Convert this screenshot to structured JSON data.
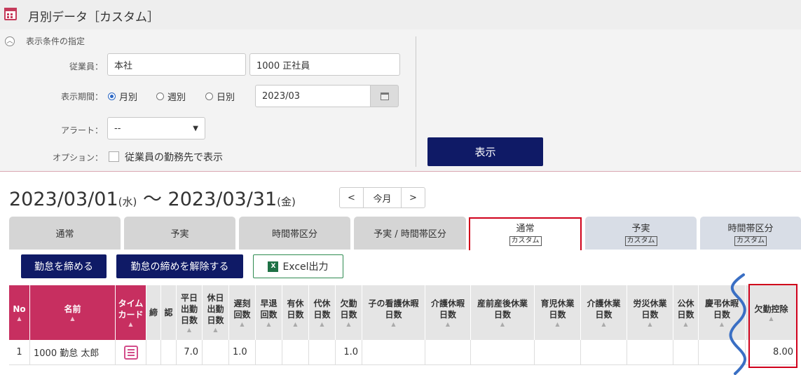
{
  "title_bar": {
    "title": "月別データ［カスタム］",
    "icon": "calendar-icon"
  },
  "conditions": {
    "heading": "表示条件の指定",
    "employee_label": "従業員：",
    "employee_org": "本社",
    "employee_value": "1000 正社員",
    "period_label": "表示期間：",
    "period_options": [
      "月別",
      "週別",
      "日別"
    ],
    "period_selected": "月別",
    "period_date": "2023/03",
    "alert_label": "アラート：",
    "alert_value": "--",
    "option_label": "オプション：",
    "option_checkbox_label": "従業員の勤務先で表示",
    "option_checked": false,
    "show_button": "表示"
  },
  "date_range": {
    "start": "2023/03/01",
    "start_dow": "(水)",
    "separator": "〜",
    "end": "2023/03/31",
    "end_dow": "(金)"
  },
  "nav": {
    "prev": "<",
    "current": "今月",
    "next": ">"
  },
  "tabs": [
    {
      "label": "通常",
      "sub": ""
    },
    {
      "label": "予実",
      "sub": ""
    },
    {
      "label": "時間帯区分",
      "sub": ""
    },
    {
      "label": "予実 / 時間帯区分",
      "sub": ""
    },
    {
      "label": "通常",
      "sub": "カスタム",
      "active": true
    },
    {
      "label": "予実",
      "sub": "カスタム"
    },
    {
      "label": "時間帯区分",
      "sub": "カスタム"
    }
  ],
  "toolbar": {
    "close_button": "勤怠を締める",
    "unclose_button": "勤怠の締めを解除する",
    "excel_button": "Excel出力",
    "excel_icon_letter": "X"
  },
  "table": {
    "headers": [
      "No",
      "名前",
      "タイムカード",
      "締",
      "認",
      "平日出勤日数",
      "休日出勤日数",
      "遅刻回数",
      "早退回数",
      "有休日数",
      "代休日数",
      "欠勤日数",
      "子の看護休暇日数",
      "介護休暇日数",
      "産前産後休業日数",
      "育児休業日数",
      "介護休業日数",
      "労災休業日数",
      "公休日数",
      "慶弔休暇日数",
      "欠勤控除"
    ],
    "header_lines": [
      [
        "No"
      ],
      [
        "名前"
      ],
      [
        "タイム",
        "カード"
      ],
      [
        "締"
      ],
      [
        "認"
      ],
      [
        "平日",
        "出勤",
        "日数"
      ],
      [
        "休日",
        "出勤",
        "日数"
      ],
      [
        "遅刻",
        "回数"
      ],
      [
        "早退",
        "回数"
      ],
      [
        "有休",
        "日数"
      ],
      [
        "代休",
        "日数"
      ],
      [
        "欠勤",
        "日数"
      ],
      [
        "子の看護休暇",
        "日数"
      ],
      [
        "介護休暇",
        "日数"
      ],
      [
        "産前産後休業",
        "日数"
      ],
      [
        "育児休業",
        "日数"
      ],
      [
        "介護休業",
        "日数"
      ],
      [
        "労災休業",
        "日数"
      ],
      [
        "公休",
        "日数"
      ],
      [
        "慶弔休暇",
        "日数"
      ],
      [
        "欠勤控除"
      ]
    ],
    "rows": [
      {
        "no": "1",
        "name": "1000 勤怠 太郎",
        "weekday_days": "7.0",
        "late_count": "1.0",
        "absence_days": "1.0",
        "absence_deduction": "8.00"
      }
    ]
  },
  "colors": {
    "navy": "#0f1a66",
    "pink": "#c72f60",
    "highlight": "#d0011b",
    "wave": "#3a6fc4"
  }
}
